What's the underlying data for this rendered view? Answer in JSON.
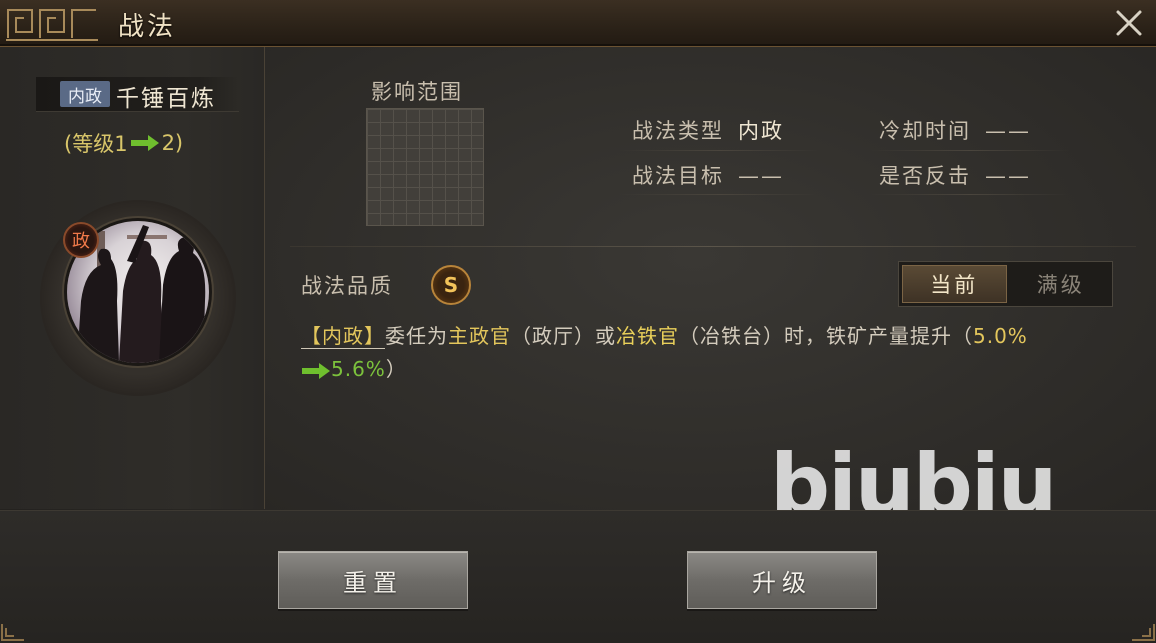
{
  "window": {
    "title": "战法"
  },
  "skill": {
    "tag": "内政",
    "name": "千锤百炼",
    "level_open": "(等级1",
    "level_close": "2)",
    "badge": "政"
  },
  "range": {
    "label": "影响范围"
  },
  "info": {
    "type_label": "战法类型",
    "type_value": "内政",
    "cooldown_label": "冷却时间",
    "cooldown_value": "——",
    "target_label": "战法目标",
    "target_value": "——",
    "counter_label": "是否反击",
    "counter_value": "——"
  },
  "quality": {
    "label": "战法品质",
    "grade": "S"
  },
  "toggle": {
    "current": "当前",
    "max": "满级"
  },
  "description": {
    "tag": "【内政】",
    "part1": "委任为",
    "role1": "主政官",
    "part2": "（政厅）或",
    "role2": "冶铁官",
    "part3": "（冶铁台）时，铁矿产量提升（",
    "value_from": "5.0%",
    "value_to": "5.6%",
    "close": "）"
  },
  "watermark": "biubiu",
  "buttons": {
    "reset": "重置",
    "upgrade": "升级"
  },
  "colors": {
    "gold": "#e3c65c",
    "green": "#7cc23c",
    "accent": "#b8843a"
  }
}
